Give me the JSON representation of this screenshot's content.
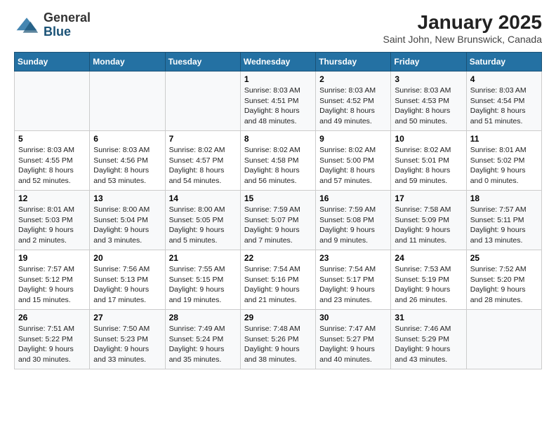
{
  "header": {
    "logo_general": "General",
    "logo_blue": "Blue",
    "title": "January 2025",
    "subtitle": "Saint John, New Brunswick, Canada"
  },
  "calendar": {
    "days_of_week": [
      "Sunday",
      "Monday",
      "Tuesday",
      "Wednesday",
      "Thursday",
      "Friday",
      "Saturday"
    ],
    "weeks": [
      [
        {
          "day": "",
          "info": ""
        },
        {
          "day": "",
          "info": ""
        },
        {
          "day": "",
          "info": ""
        },
        {
          "day": "1",
          "info": "Sunrise: 8:03 AM\nSunset: 4:51 PM\nDaylight: 8 hours\nand 48 minutes."
        },
        {
          "day": "2",
          "info": "Sunrise: 8:03 AM\nSunset: 4:52 PM\nDaylight: 8 hours\nand 49 minutes."
        },
        {
          "day": "3",
          "info": "Sunrise: 8:03 AM\nSunset: 4:53 PM\nDaylight: 8 hours\nand 50 minutes."
        },
        {
          "day": "4",
          "info": "Sunrise: 8:03 AM\nSunset: 4:54 PM\nDaylight: 8 hours\nand 51 minutes."
        }
      ],
      [
        {
          "day": "5",
          "info": "Sunrise: 8:03 AM\nSunset: 4:55 PM\nDaylight: 8 hours\nand 52 minutes."
        },
        {
          "day": "6",
          "info": "Sunrise: 8:03 AM\nSunset: 4:56 PM\nDaylight: 8 hours\nand 53 minutes."
        },
        {
          "day": "7",
          "info": "Sunrise: 8:02 AM\nSunset: 4:57 PM\nDaylight: 8 hours\nand 54 minutes."
        },
        {
          "day": "8",
          "info": "Sunrise: 8:02 AM\nSunset: 4:58 PM\nDaylight: 8 hours\nand 56 minutes."
        },
        {
          "day": "9",
          "info": "Sunrise: 8:02 AM\nSunset: 5:00 PM\nDaylight: 8 hours\nand 57 minutes."
        },
        {
          "day": "10",
          "info": "Sunrise: 8:02 AM\nSunset: 5:01 PM\nDaylight: 8 hours\nand 59 minutes."
        },
        {
          "day": "11",
          "info": "Sunrise: 8:01 AM\nSunset: 5:02 PM\nDaylight: 9 hours\nand 0 minutes."
        }
      ],
      [
        {
          "day": "12",
          "info": "Sunrise: 8:01 AM\nSunset: 5:03 PM\nDaylight: 9 hours\nand 2 minutes."
        },
        {
          "day": "13",
          "info": "Sunrise: 8:00 AM\nSunset: 5:04 PM\nDaylight: 9 hours\nand 3 minutes."
        },
        {
          "day": "14",
          "info": "Sunrise: 8:00 AM\nSunset: 5:05 PM\nDaylight: 9 hours\nand 5 minutes."
        },
        {
          "day": "15",
          "info": "Sunrise: 7:59 AM\nSunset: 5:07 PM\nDaylight: 9 hours\nand 7 minutes."
        },
        {
          "day": "16",
          "info": "Sunrise: 7:59 AM\nSunset: 5:08 PM\nDaylight: 9 hours\nand 9 minutes."
        },
        {
          "day": "17",
          "info": "Sunrise: 7:58 AM\nSunset: 5:09 PM\nDaylight: 9 hours\nand 11 minutes."
        },
        {
          "day": "18",
          "info": "Sunrise: 7:57 AM\nSunset: 5:11 PM\nDaylight: 9 hours\nand 13 minutes."
        }
      ],
      [
        {
          "day": "19",
          "info": "Sunrise: 7:57 AM\nSunset: 5:12 PM\nDaylight: 9 hours\nand 15 minutes."
        },
        {
          "day": "20",
          "info": "Sunrise: 7:56 AM\nSunset: 5:13 PM\nDaylight: 9 hours\nand 17 minutes."
        },
        {
          "day": "21",
          "info": "Sunrise: 7:55 AM\nSunset: 5:15 PM\nDaylight: 9 hours\nand 19 minutes."
        },
        {
          "day": "22",
          "info": "Sunrise: 7:54 AM\nSunset: 5:16 PM\nDaylight: 9 hours\nand 21 minutes."
        },
        {
          "day": "23",
          "info": "Sunrise: 7:54 AM\nSunset: 5:17 PM\nDaylight: 9 hours\nand 23 minutes."
        },
        {
          "day": "24",
          "info": "Sunrise: 7:53 AM\nSunset: 5:19 PM\nDaylight: 9 hours\nand 26 minutes."
        },
        {
          "day": "25",
          "info": "Sunrise: 7:52 AM\nSunset: 5:20 PM\nDaylight: 9 hours\nand 28 minutes."
        }
      ],
      [
        {
          "day": "26",
          "info": "Sunrise: 7:51 AM\nSunset: 5:22 PM\nDaylight: 9 hours\nand 30 minutes."
        },
        {
          "day": "27",
          "info": "Sunrise: 7:50 AM\nSunset: 5:23 PM\nDaylight: 9 hours\nand 33 minutes."
        },
        {
          "day": "28",
          "info": "Sunrise: 7:49 AM\nSunset: 5:24 PM\nDaylight: 9 hours\nand 35 minutes."
        },
        {
          "day": "29",
          "info": "Sunrise: 7:48 AM\nSunset: 5:26 PM\nDaylight: 9 hours\nand 38 minutes."
        },
        {
          "day": "30",
          "info": "Sunrise: 7:47 AM\nSunset: 5:27 PM\nDaylight: 9 hours\nand 40 minutes."
        },
        {
          "day": "31",
          "info": "Sunrise: 7:46 AM\nSunset: 5:29 PM\nDaylight: 9 hours\nand 43 minutes."
        },
        {
          "day": "",
          "info": ""
        }
      ]
    ]
  }
}
